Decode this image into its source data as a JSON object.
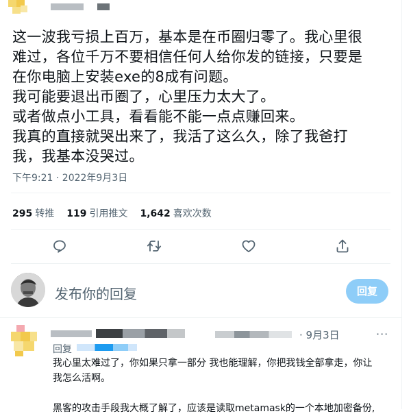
{
  "tweet": {
    "lines": [
      "这一波我亏损上百万，基本是在币圈归零了。我心里很",
      "难过，各位千万不要相信任何人给你发的链接，只要是",
      "在你电脑上安装exe的8成有问题。",
      "我可能要退出币圈了，心里压力太大了。",
      "或者做点小工具，看看能不能一点点赚回来。",
      "我真的直接就哭出来了，我活了这么久，除了我爸打",
      "我，我基本没哭过。"
    ],
    "timestamp": "下午9:21 · 2022年9月3日"
  },
  "stats": {
    "retweets_count": "295",
    "retweets_label": "转推",
    "quotes_count": "119",
    "quotes_label": "引用推文",
    "likes_count": "1,642",
    "likes_label": "喜欢次数"
  },
  "actions": [
    "reply-icon",
    "retweet-icon",
    "like-icon",
    "share-icon"
  ],
  "composer": {
    "placeholder": "发布你的回复",
    "button_label": "回复"
  },
  "reply": {
    "time": "· 9月3日",
    "replying_prefix": "回复",
    "lines": [
      "我心里太难过了，你如果只拿一部分 我也能理解，你把我钱全部拿走，你让",
      "我怎么活啊。",
      "",
      "黑客的攻击手段我大概了解了，应该是读取metamask的一个本地加密备份,"
    ]
  },
  "colors": {
    "text": "#0f1419",
    "secondary": "#536471",
    "accent": "#1d9bf0",
    "button_disabled": "#8ecdf8",
    "border": "#eff3f4"
  }
}
